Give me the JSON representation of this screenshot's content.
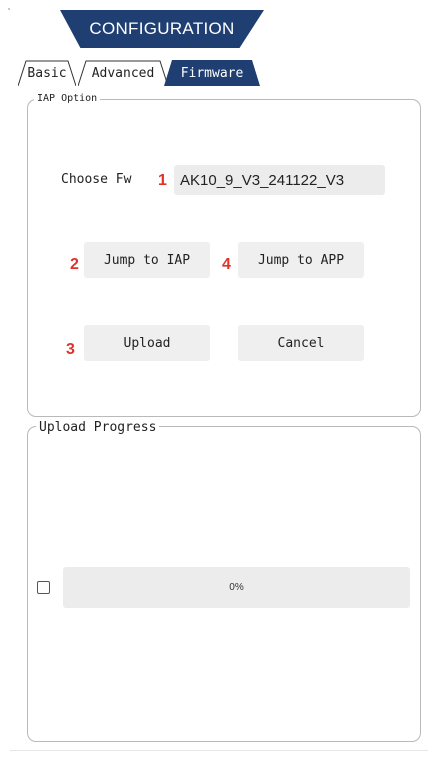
{
  "header": {
    "title": "CONFIGURATION"
  },
  "tabs": [
    {
      "label": "Basic",
      "active": false
    },
    {
      "label": "Advanced",
      "active": false
    },
    {
      "label": "Firmware",
      "active": true
    }
  ],
  "iap_group": {
    "title": "IAP Option",
    "choose_fw_label": "Choose Fw",
    "fw_value": "AK10_9_V3_241122_V3",
    "buttons": {
      "jump_iap": "Jump to IAP",
      "jump_app": "Jump to APP",
      "upload": "Upload",
      "cancel": "Cancel"
    },
    "badges": {
      "fw": "1",
      "jump_iap": "2",
      "upload": "3",
      "jump_app": "4"
    }
  },
  "progress_group": {
    "title": "Upload Progress",
    "checkbox_checked": false,
    "progress_value": 0,
    "progress_text": "0%"
  },
  "colors": {
    "accent": "#1f3f73",
    "badge": "#e0322b",
    "control_bg": "#efefef"
  }
}
